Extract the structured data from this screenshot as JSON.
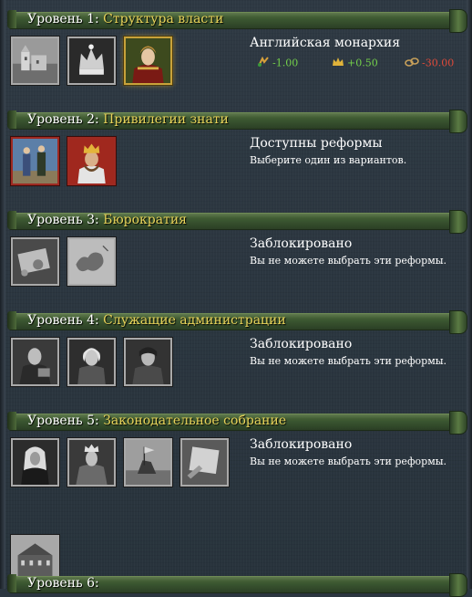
{
  "levels": [
    {
      "prefix": "Уровень 1:",
      "name": "Структура власти",
      "title": "Английская монархия",
      "subtitle": "",
      "modifiers": [
        {
          "icon": "stability-cost-icon",
          "value": "-1.00"
        },
        {
          "icon": "crown-icon",
          "value": "+0.50"
        },
        {
          "icon": "chains-icon",
          "value": "-30.00"
        }
      ],
      "reforms": [
        "castle-reform-icon",
        "crown-reform-icon",
        "queen-portrait-reform-icon"
      ]
    },
    {
      "prefix": "Уровень 2:",
      "name": "Привилегии знати",
      "title": "Доступны реформы",
      "subtitle": "Выберите один из вариантов.",
      "reforms": [
        "nobles-reform-icon",
        "king-reform-icon"
      ]
    },
    {
      "prefix": "Уровень 3:",
      "name": "Бюрократия",
      "title": "Заблокировано",
      "subtitle": "Вы не можете выбрать эти реформы.",
      "reforms": [
        "sealed-letter-reform-icon",
        "map-reform-icon"
      ]
    },
    {
      "prefix": "Уровень 4:",
      "name": "Служащие администрации",
      "title": "Заблокировано",
      "subtitle": "Вы не можете выбрать эти реформы.",
      "reforms": [
        "official-reform-icon",
        "statesman-reform-icon",
        "governor-reform-icon"
      ]
    },
    {
      "prefix": "Уровень 5:",
      "name": "Законодательное собрание",
      "title": "Заблокировано",
      "subtitle": "Вы не можете выбрать эти реформы.",
      "reforms": [
        "judge-reform-icon",
        "monarch-reform-icon",
        "knights-reform-icon",
        "document-reform-icon",
        "parliament-building-reform-icon"
      ]
    },
    {
      "prefix": "Уровень 6:",
      "name": "",
      "title": "",
      "subtitle": "",
      "reforms": []
    }
  ],
  "colors": {
    "level_prefix": "#ffffff",
    "level_name": "#e8d35a",
    "positive": "#74d04a",
    "negative": "#e04a3a",
    "banner": "#3a5530"
  }
}
